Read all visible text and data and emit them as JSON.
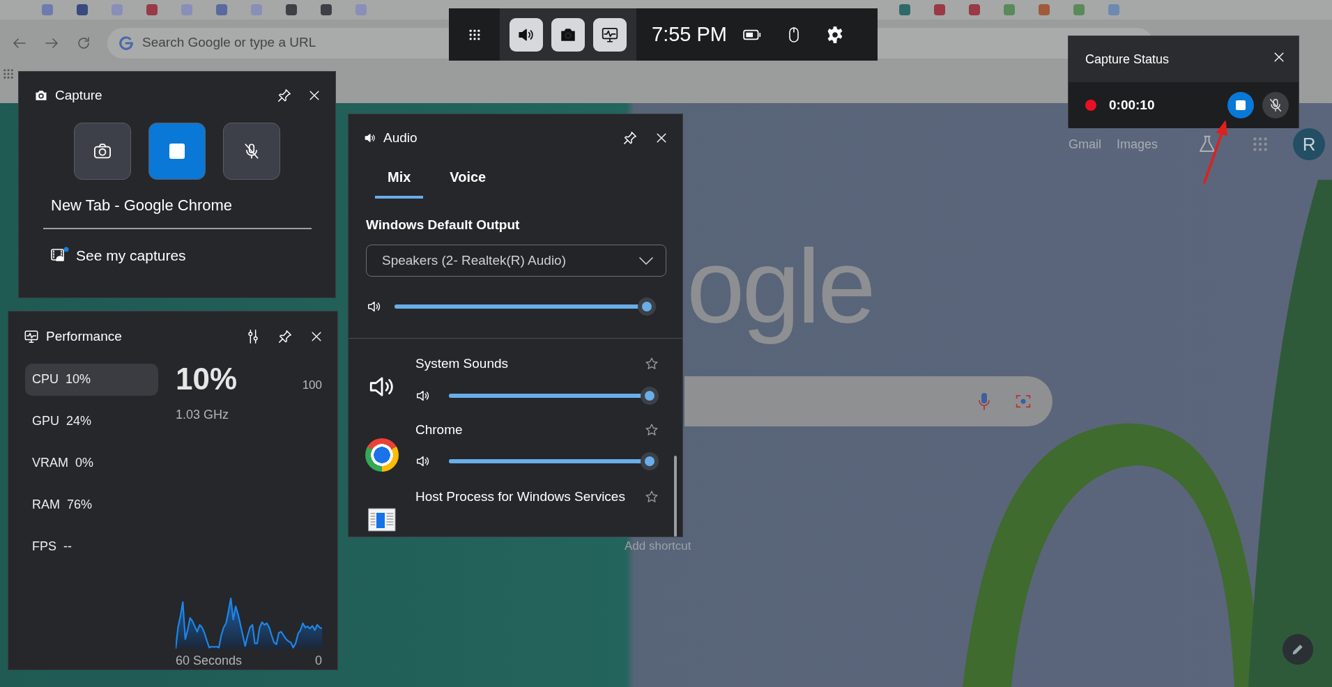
{
  "browser": {
    "omnibox": {
      "placeholder": "Search Google or type a URL"
    },
    "new_tab": {
      "logo": "ogle",
      "links": [
        "Gmail",
        "Images"
      ],
      "avatar": "R",
      "shortcut_label": "Add shortcut"
    }
  },
  "game_bar": {
    "buttons": [
      {
        "kind": "audio",
        "selected": true
      },
      {
        "kind": "capture",
        "selected": true
      },
      {
        "kind": "performance",
        "selected": true
      }
    ],
    "time": "7:55 PM"
  },
  "capture": {
    "title": "Capture",
    "recording": true,
    "mic_muted": true,
    "target": "New Tab - Google Chrome",
    "link": "See my captures",
    "new_badge": true
  },
  "performance": {
    "title": "Performance",
    "metrics": [
      {
        "label": "CPU",
        "value": "10%",
        "selected": true
      },
      {
        "label": "GPU",
        "value": "24%",
        "selected": false
      },
      {
        "label": "VRAM",
        "value": "0%",
        "selected": false
      },
      {
        "label": "RAM",
        "value": "76%",
        "selected": false
      },
      {
        "label": "FPS",
        "value": "--",
        "selected": false
      }
    ],
    "big_value": "10%",
    "detail": "1.03 GHz",
    "scale_max": "100",
    "scale_min": "0",
    "span": "60 Seconds"
  },
  "audio": {
    "title": "Audio",
    "tabs": [
      {
        "label": "Mix",
        "selected": true
      },
      {
        "label": "Voice",
        "selected": false
      }
    ],
    "output_heading": "Windows Default Output",
    "device": "Speakers (2- Realtek(R) Audio)",
    "master": {
      "level": 1
    },
    "apps": [
      {
        "name": "System Sounds",
        "kind": "system",
        "level": 1,
        "favorite": false
      },
      {
        "name": "Chrome",
        "kind": "chrome",
        "level": 1,
        "favorite": false
      },
      {
        "name": "Host Process for Windows Services",
        "kind": "host",
        "favorite": false
      }
    ]
  },
  "capture_status": {
    "title": "Capture Status",
    "recording": true,
    "elapsed": "0:00:10",
    "mic_muted": true
  }
}
